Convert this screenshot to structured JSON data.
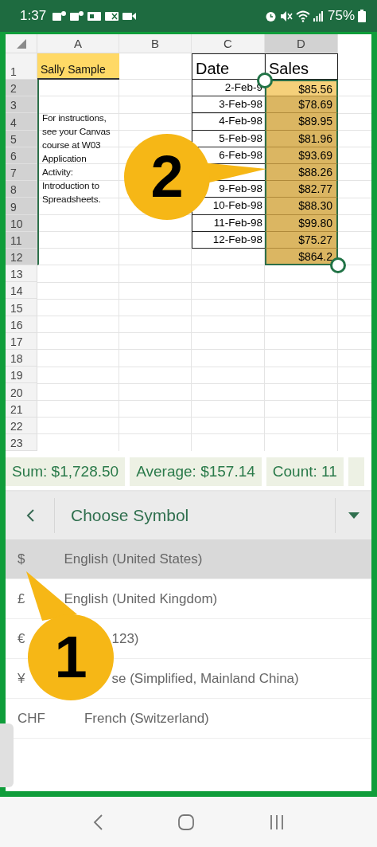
{
  "status_bar": {
    "time": "1:37",
    "battery": "75%"
  },
  "sheet": {
    "columns": [
      {
        "label": "A",
        "selected": false
      },
      {
        "label": "B",
        "selected": false
      },
      {
        "label": "C",
        "selected": false
      },
      {
        "label": "D",
        "selected": true
      }
    ],
    "rows": [
      {
        "number": "1",
        "selected": false
      },
      {
        "number": "2",
        "selected": true
      },
      {
        "number": "3",
        "selected": true
      },
      {
        "number": "4",
        "selected": true
      },
      {
        "number": "5",
        "selected": true
      },
      {
        "number": "6",
        "selected": true
      },
      {
        "number": "7",
        "selected": true
      },
      {
        "number": "8",
        "selected": true
      },
      {
        "number": "9",
        "selected": true
      },
      {
        "number": "10",
        "selected": true
      },
      {
        "number": "11",
        "selected": true
      },
      {
        "number": "12",
        "selected": true
      },
      {
        "number": "13",
        "selected": false
      },
      {
        "number": "14",
        "selected": false
      },
      {
        "number": "15",
        "selected": false
      },
      {
        "number": "16",
        "selected": false
      },
      {
        "number": "17",
        "selected": false
      },
      {
        "number": "18",
        "selected": false
      },
      {
        "number": "19",
        "selected": false
      },
      {
        "number": "20",
        "selected": false
      },
      {
        "number": "21",
        "selected": false
      },
      {
        "number": "22",
        "selected": false
      },
      {
        "number": "23",
        "selected": false
      }
    ],
    "name_cell": "Sally Sample",
    "note": "For instructions, see your Canvas course at W03 Application Activity: Introduction to Spreadsheets.",
    "date_header": "Date",
    "sales_header": "Sales",
    "data_rows": [
      {
        "kind": "entry",
        "date": "2-Feb-9",
        "sales": "$85.56",
        "active": true
      },
      {
        "kind": "entry",
        "date": "3-Feb-98",
        "sales": "$78.69",
        "active": false
      },
      {
        "kind": "entry",
        "date": "4-Feb-98",
        "sales": "$89.95",
        "active": false
      },
      {
        "kind": "entry",
        "date": "5-Feb-98",
        "sales": "$81.96",
        "active": false
      },
      {
        "kind": "entry",
        "date": "6-Feb-98",
        "sales": "$93.69",
        "active": false
      },
      {
        "kind": "entry",
        "sales": "$88.26",
        "active": false
      },
      {
        "kind": "entry",
        "date": "9-Feb-98",
        "sales": "$82.77",
        "active": false
      },
      {
        "kind": "entry",
        "date": "10-Feb-98",
        "sales": "$88.30",
        "active": false
      },
      {
        "kind": "entry",
        "date": "11-Feb-98",
        "sales": "$99.80",
        "active": false
      },
      {
        "kind": "entry",
        "date": "12-Feb-98",
        "sales": "$75.27",
        "active": false
      },
      {
        "kind": "total",
        "sales": "$864.2",
        "active": false
      }
    ]
  },
  "summary": [
    "Sum: $1,728.50",
    "Average: $157.14",
    "Count: 11"
  ],
  "panel": {
    "title": "Choose Symbol"
  },
  "symbols": [
    {
      "symbol": "$",
      "language": "English (United States)",
      "selected": true,
      "covered": false
    },
    {
      "symbol": "£",
      "language": "English (United Kingdom)",
      "selected": false,
      "covered": false
    },
    {
      "symbol": "€",
      "language": "123)",
      "selected": false,
      "covered": true
    },
    {
      "symbol": "¥",
      "language": "se (Simplified, Mainland China)",
      "selected": false,
      "covered": true
    },
    {
      "symbol": "CHF",
      "language": "French (Switzerland)",
      "selected": false,
      "covered": false
    }
  ],
  "callouts": [
    {
      "number": "2"
    },
    {
      "number": "1"
    }
  ]
}
